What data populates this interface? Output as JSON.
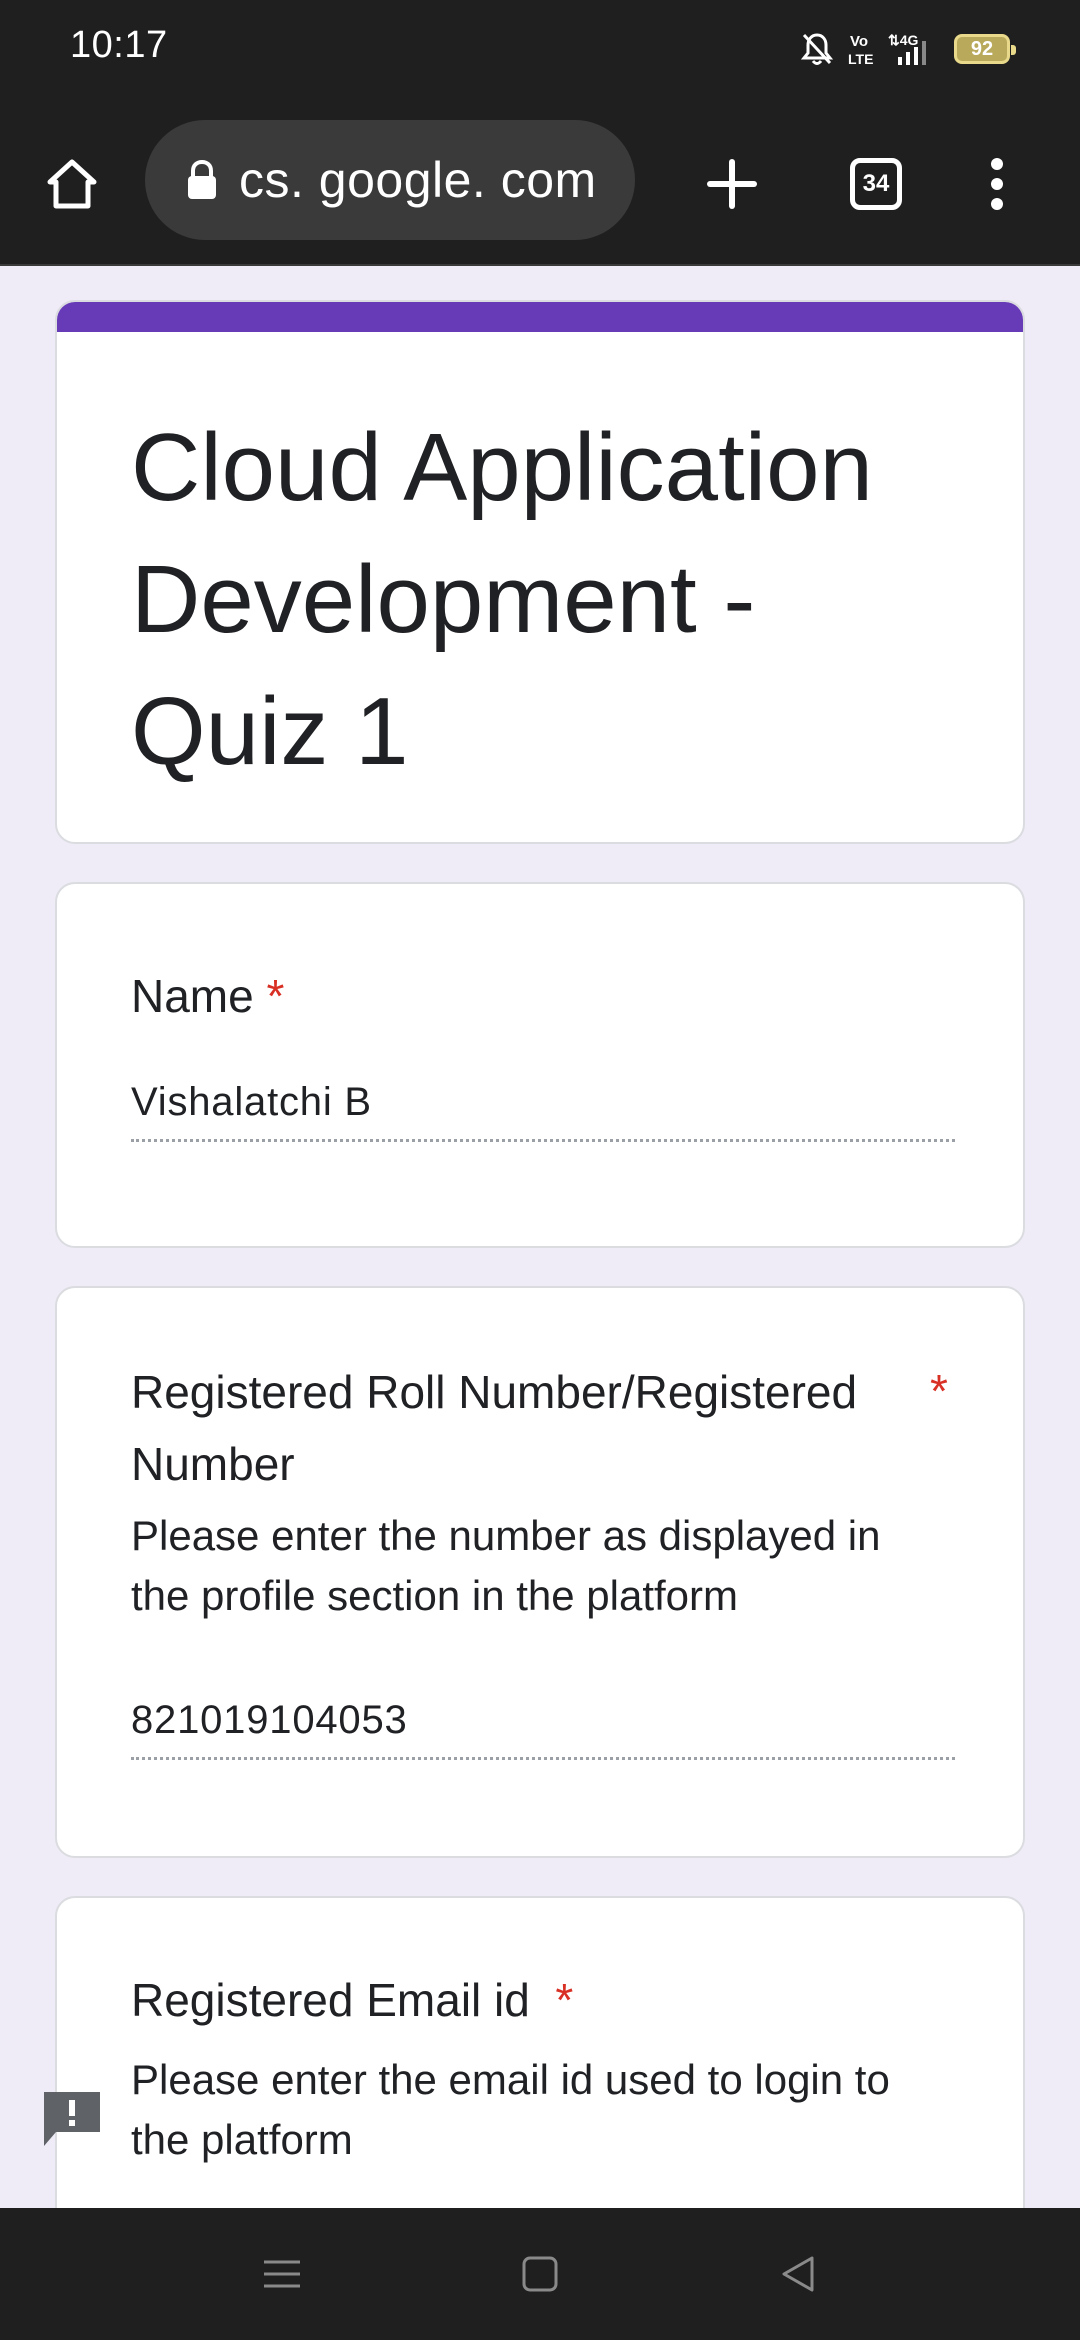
{
  "status_bar": {
    "time": "10:17",
    "battery": "92",
    "icons": [
      "bell-off-icon",
      "volte-icon",
      "4g-signal-icon",
      "battery-icon"
    ]
  },
  "browser": {
    "url": "cs. google. com",
    "tab_count": "34",
    "icons": [
      "home-icon",
      "lock-icon",
      "plus-icon",
      "tabs-icon",
      "more-vert-icon"
    ]
  },
  "form": {
    "accent_color": "#673ab7",
    "title": "Cloud Application Development - Quiz 1",
    "questions": [
      {
        "label": "Name",
        "required": "*",
        "description": "",
        "answer": "Vishalatchi B"
      },
      {
        "label_line1": "Registered Roll Number/Registered",
        "label_line2": "Number",
        "required": "*",
        "description_line1": "Please enter the number as displayed in",
        "description_line2": "the profile section in the platform",
        "answer": "821019104053"
      },
      {
        "label": "Registered Email id",
        "required": "*",
        "description_line1": "Please enter the email id used to login to",
        "description_line2": "the platform"
      }
    ],
    "required_color": "#d93025"
  },
  "nav_bar": {
    "icons": [
      "recents-menu-icon",
      "home-square-icon",
      "back-triangle-icon"
    ]
  }
}
